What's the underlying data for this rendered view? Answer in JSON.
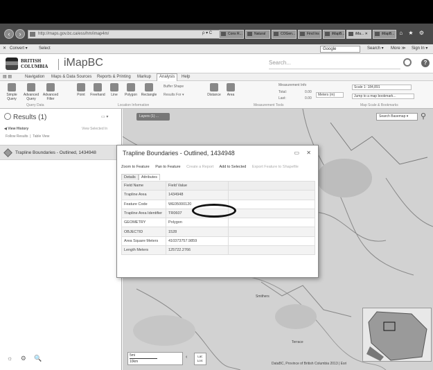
{
  "browser": {
    "url": "http://maps.gov.bc.ca/ess/hm/imap4m/",
    "addr_tools": "ρ ▾ C",
    "tabs": [
      "Cons R...",
      "Natural",
      "COGen...",
      "Find Ins",
      "iMapB...",
      "iMa... ✕",
      "iMapB..."
    ],
    "win_controls": "⌂ ★ ⚙",
    "toolbar": {
      "convert": "Convert ▾",
      "select": "Select",
      "search_engine": "Google",
      "search_btn": "Search ▾",
      "more": "More ≫",
      "signin": "Sign In ▾"
    }
  },
  "app": {
    "logo_line1": "BRITISH",
    "logo_line2": "COLUMBIA",
    "title": "iMapBC",
    "search_placeholder": "Search...",
    "help": "?"
  },
  "ribbon": {
    "tabs": [
      "Navigation",
      "Maps & Data Sources",
      "Reports & Printing",
      "Markup",
      "Analysis",
      "Help"
    ],
    "active_tab": "Analysis",
    "buttons": [
      {
        "label": "Simple Query"
      },
      {
        "label": "Advanced Query"
      },
      {
        "label": "Advanced Filter"
      },
      {
        "label": "Point"
      },
      {
        "label": "Freehand"
      },
      {
        "label": "Line"
      },
      {
        "label": "Polygon"
      },
      {
        "label": "Rectangle"
      },
      {
        "label": "Distance"
      },
      {
        "label": "Area"
      }
    ],
    "buffer_shape": "Buffer Shape",
    "results_for": "Results For ▾",
    "measurement_info": "Measurement Info",
    "total_label": "Total:",
    "total_value": "0.00",
    "last_label": "Last:",
    "last_value": "0.00",
    "units": "Meters (m)",
    "scale": "Scale 1: 184,891",
    "bookmark": "Jump to a map bookmark...",
    "groups": [
      "Query Data",
      "Location Information",
      "Measurement Tools",
      "Map Scale & Bookmarks"
    ]
  },
  "results_panel": {
    "title": "Results (1)",
    "controls": "▭ ▾",
    "view_history": "◀ View History",
    "view_selected": "View Selected In",
    "follow_results": "Follow Results",
    "table_view": "Table View",
    "item_label": "Trapline Boundaries - Outlined, 1434948"
  },
  "map": {
    "layers_btn": "Layers (1) ...",
    "basemap": "Search Basemap ▾",
    "cities": [
      "Smithers",
      "Terrace"
    ],
    "scale_top": "5mi",
    "scale_bottom": "10km",
    "scale_nav": "‹",
    "latlon_line1": "Lat:",
    "latlon_line2": "Lon:",
    "attribution": "DataBC, Province of British Columbia 2013 | Esri"
  },
  "popup": {
    "title": "Trapline Boundaries - Outlined, 1434948",
    "controls": "▭ ✕",
    "actions": [
      {
        "label": "Zoom to Feature",
        "enabled": true
      },
      {
        "label": "Pan to Feature",
        "enabled": true
      },
      {
        "label": "Create a Report",
        "enabled": false
      },
      {
        "label": "Add to Selected",
        "enabled": true
      },
      {
        "label": "Export Feature to Shapefile",
        "enabled": false
      }
    ],
    "tabs": [
      "Details",
      "Attributes"
    ],
    "table_headers": [
      "Field Name",
      "Field Value"
    ],
    "rows": [
      {
        "name": "Trapline Area",
        "value": "1434948"
      },
      {
        "name": "Feature Code",
        "value": "WE05000120"
      },
      {
        "name": "Trapline Area Identifier",
        "value": "TR0607"
      },
      {
        "name": "GEOMETRY",
        "value": "Polygon"
      },
      {
        "name": "OBJECTID",
        "value": "1528"
      },
      {
        "name": "Area Square Meters",
        "value": "410373757.9859"
      },
      {
        "name": "Length Meters",
        "value": "125722.2766"
      }
    ]
  },
  "bottom_icons": [
    "☼",
    "⚙",
    "🔍"
  ]
}
